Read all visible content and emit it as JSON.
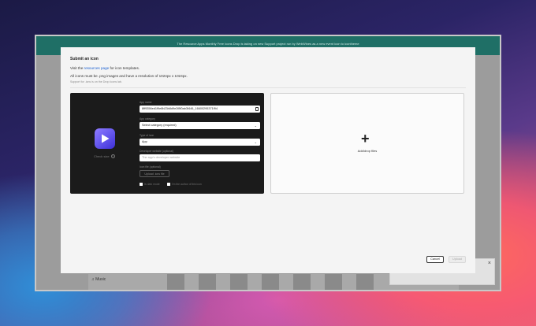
{
  "background_window": {
    "banner_text": "The Resource Apps Monthly Free Icons Drop is taking on new Support project run by WebWines as a new event icon to icontheme",
    "music_label": "Music",
    "notification_close": "×"
  },
  "modal": {
    "title": "Submit an icon",
    "intro_prefix": "Visit the",
    "intro_link": "resources page",
    "intro_suffix": "for icon templates.",
    "requirements": "All icons must be .png images and have a resolution of 1024px x 1024px.",
    "note": "Support for .icns is on the Drop Icons lab.",
    "form": {
      "app_name_label": "App name",
      "app_name_value": "8ff9356ed1f9e8b23b8d9e2f8f0ab3f446_16600295371f94",
      "app_category_label": "App category",
      "app_category_value": "Select category (required)",
      "type_label": "Type of icon",
      "type_value": "App",
      "website_label": "Developer website (optional)",
      "website_placeholder": "The app's developer website",
      "file_label": "Icon file (optional)",
      "upload_label": "Upload .icns file",
      "checkbox1_label": "Is dark mode",
      "checkbox2_label": "I'm the author of this icon",
      "check_size_label": "Check size",
      "check_size_q": "?"
    },
    "drop_zone_label": "Add/drop files",
    "drop_zone_plus": "+",
    "cancel_label": "Cancel",
    "upload_button_label": "Upload"
  },
  "colors": {
    "app_icon_gradient_start": "#8f7bff",
    "app_icon_gradient_end": "#3d2fd6",
    "link": "#1a5fd0",
    "banner": "#1f6f66"
  }
}
